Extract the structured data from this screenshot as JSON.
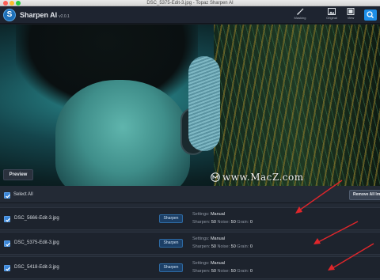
{
  "window": {
    "title": "DSC_5375-Edit-3.jpg - Topaz Sharpen AI"
  },
  "app": {
    "name": "Sharpen AI",
    "version": "v2.0.1",
    "logo_letter": "S"
  },
  "toolbar": {
    "masking_label": "Masking",
    "original_label": "Original",
    "view_label": "View",
    "search_icon": "search-icon"
  },
  "preview": {
    "button_label": "Preview",
    "watermark": "www.MacZ.com"
  },
  "list": {
    "select_all_label": "Select All",
    "remove_all_label": "Remove All Im",
    "settings_prefix": "Settings:",
    "sharpen_label": "Sharpen",
    "noise_label": "Noise:",
    "grain_label": "Grain:",
    "files": [
      {
        "name": "DSC_5666-Edit-3.jpg",
        "button": "Sharpen",
        "mode": "Manual",
        "sharpen": "50",
        "noise": "50",
        "grain": "0"
      },
      {
        "name": "DSC_5375-Edit-3.jpg",
        "button": "Sharpen",
        "mode": "Manual",
        "sharpen": "50",
        "noise": "50",
        "grain": "0"
      },
      {
        "name": "DSC_5418-Edit-3.jpg",
        "button": "Sharpen",
        "mode": "Manual",
        "sharpen": "50",
        "noise": "50",
        "grain": "0"
      }
    ]
  },
  "colors": {
    "accent": "#1d8ee8",
    "annotation_arrow": "#e0262b",
    "panel_bg": "#232a35",
    "row_bg": "#1d232d"
  }
}
